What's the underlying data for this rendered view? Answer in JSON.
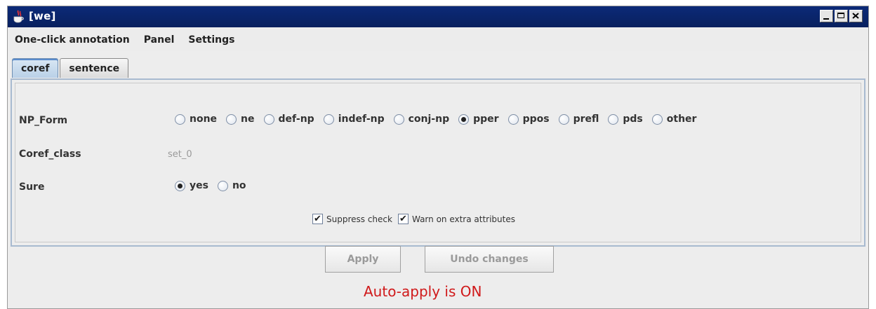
{
  "window": {
    "title": "[we]",
    "icon": "java-cup-icon"
  },
  "menu": [
    "One-click annotation",
    "Panel",
    "Settings"
  ],
  "tabs": [
    {
      "label": "coref",
      "active": true
    },
    {
      "label": "sentence",
      "active": false
    }
  ],
  "form": {
    "np_form": {
      "label": "NP_Form",
      "options": [
        "none",
        "ne",
        "def-np",
        "indef-np",
        "conj-np",
        "pper",
        "ppos",
        "prefl",
        "pds",
        "other"
      ],
      "selected": "pper"
    },
    "coref_class": {
      "label": "Coref_class",
      "value": "set_0"
    },
    "sure": {
      "label": "Sure",
      "options": [
        "yes",
        "no"
      ],
      "selected": "yes"
    },
    "suppress_check": {
      "label": "Suppress check",
      "checked": true
    },
    "warn_extra": {
      "label": "Warn on extra attributes",
      "checked": true
    }
  },
  "buttons": {
    "apply": "Apply",
    "undo": "Undo changes"
  },
  "status_text": "Auto-apply is ON",
  "colors": {
    "titlebar": "#0c2a78",
    "status": "#d0191a",
    "active_tab": "#b9d0e7"
  }
}
